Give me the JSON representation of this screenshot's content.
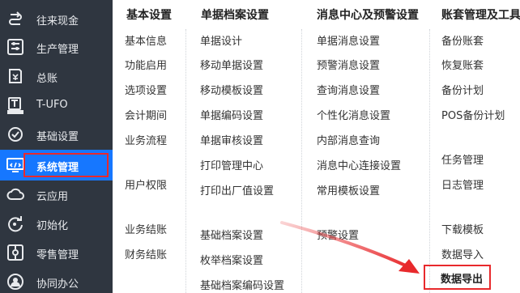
{
  "sidebar": {
    "items": [
      {
        "label": "往来现金",
        "icon": "refresh-cash-icon"
      },
      {
        "label": "生产管理",
        "icon": "production-sliders-icon"
      },
      {
        "label": "总账",
        "icon": "ledger-book-icon"
      },
      {
        "label": "T-UFO",
        "icon": "ufo-report-icon"
      },
      {
        "label": "基础设置",
        "icon": "settings-icon"
      },
      {
        "label": "系统管理",
        "icon": "system-monitor-icon",
        "active": true
      },
      {
        "label": "云应用",
        "icon": "cloud-icon"
      },
      {
        "label": "初始化",
        "icon": "initialize-icon"
      },
      {
        "label": "零售管理",
        "icon": "retail-icon"
      },
      {
        "label": "协同办公",
        "icon": "collaborate-icon"
      }
    ]
  },
  "columns": {
    "basic": {
      "title": "基本设置",
      "items": [
        "基本信息",
        "功能启用",
        "选项设置",
        "会计期间",
        "业务流程",
        "用户权限",
        "业务结账",
        "财务结账"
      ]
    },
    "docs": {
      "title": "单据档案设置",
      "items": [
        "单据设计",
        "移动单据设置",
        "移动模板设置",
        "单据编码设置",
        "单据审核设置",
        "打印管理中心",
        "打印出厂值设置",
        "基础档案设置",
        "枚举档案设置",
        "基础档案编码设置"
      ]
    },
    "messages": {
      "title": "消息中心及预警设置",
      "items": [
        "单据消息设置",
        "预警消息设置",
        "查询消息设置",
        "个性化消息设置",
        "内部消息查询",
        "消息中心连接设置",
        "常用模板设置",
        "预警设置"
      ]
    },
    "accounts": {
      "title": "账套管理及工具",
      "items": [
        "备份账套",
        "恢复账套",
        "备份计划",
        "POS备份计划",
        "任务管理",
        "日志管理",
        "下载模板",
        "数据导入",
        "数据导出"
      ]
    }
  },
  "colors": {
    "sidebar_bg": "#2f3640",
    "active_bg": "#1677ff",
    "highlight_red": "#e8292c"
  }
}
